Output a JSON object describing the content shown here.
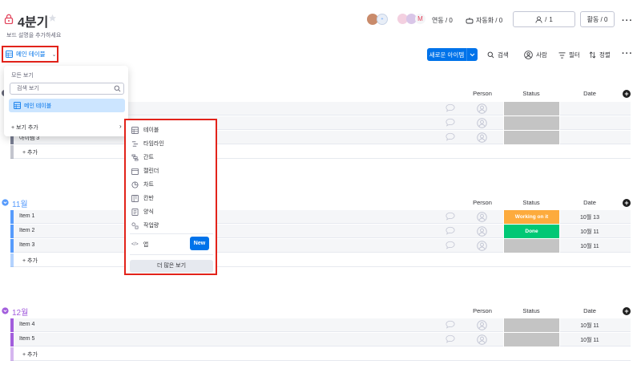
{
  "board": {
    "title": "4분기",
    "subtitle": "보드 설명을 추가하세요",
    "avatar_badge": "+"
  },
  "header": {
    "integration_label": "연동 / 0",
    "automation_label": "자동화 / 0",
    "invite_label": "1",
    "activity_label": "활동 / 0",
    "more_icon": "ellipsis-icon"
  },
  "viewbar": {
    "main_table": "메인 테이블",
    "new_item": "새로운 아이템",
    "search": "검색",
    "person": "사람",
    "filter": "필터",
    "sort": "정렬"
  },
  "dropdown": {
    "all_views": "모든 보기",
    "search_placeholder": "검색 보기",
    "selected_view": "메인 테이블",
    "add_view": "+ 보기 추가"
  },
  "submenu": {
    "items": [
      "테이블",
      "타임라인",
      "간트",
      "캘린더",
      "차트",
      "칸반",
      "양식",
      "작업량"
    ],
    "app_label": "앱",
    "new_label": "New",
    "more_views": "더 많은 보기"
  },
  "columns": {
    "person": "Person",
    "status": "Status",
    "date": "Date"
  },
  "groups": [
    {
      "name": "",
      "color": "#797e93",
      "rows": [
        {
          "name": "",
          "status": "",
          "date": ""
        },
        {
          "name": "",
          "status": "",
          "date": ""
        },
        {
          "name": "아이템 3",
          "status": "",
          "date": ""
        }
      ],
      "add_label": "+ 추가"
    },
    {
      "name": "11월",
      "color": "#579bfc",
      "rows": [
        {
          "name": "Item 1",
          "status": "Working on it",
          "status_color": "#fdab3d",
          "date": "10월 13"
        },
        {
          "name": "Item 2",
          "status": "Done",
          "status_color": "#00c875",
          "date": "10월 11"
        },
        {
          "name": "Item 3",
          "status": "",
          "status_color": "#c4c4c4",
          "date": "10월 11"
        }
      ],
      "add_label": "+ 추가"
    },
    {
      "name": "12월",
      "color": "#a25ddc",
      "rows": [
        {
          "name": "Item 4",
          "status": "",
          "status_color": "#c4c4c4",
          "date": "10월 11"
        },
        {
          "name": "Item 5",
          "status": "",
          "status_color": "#c4c4c4",
          "date": "10월 11"
        }
      ],
      "add_label": "+ 추가"
    }
  ],
  "colors": {
    "accent": "#0073ea",
    "highlight": "#e2231a",
    "status_empty": "#c4c4c4"
  }
}
